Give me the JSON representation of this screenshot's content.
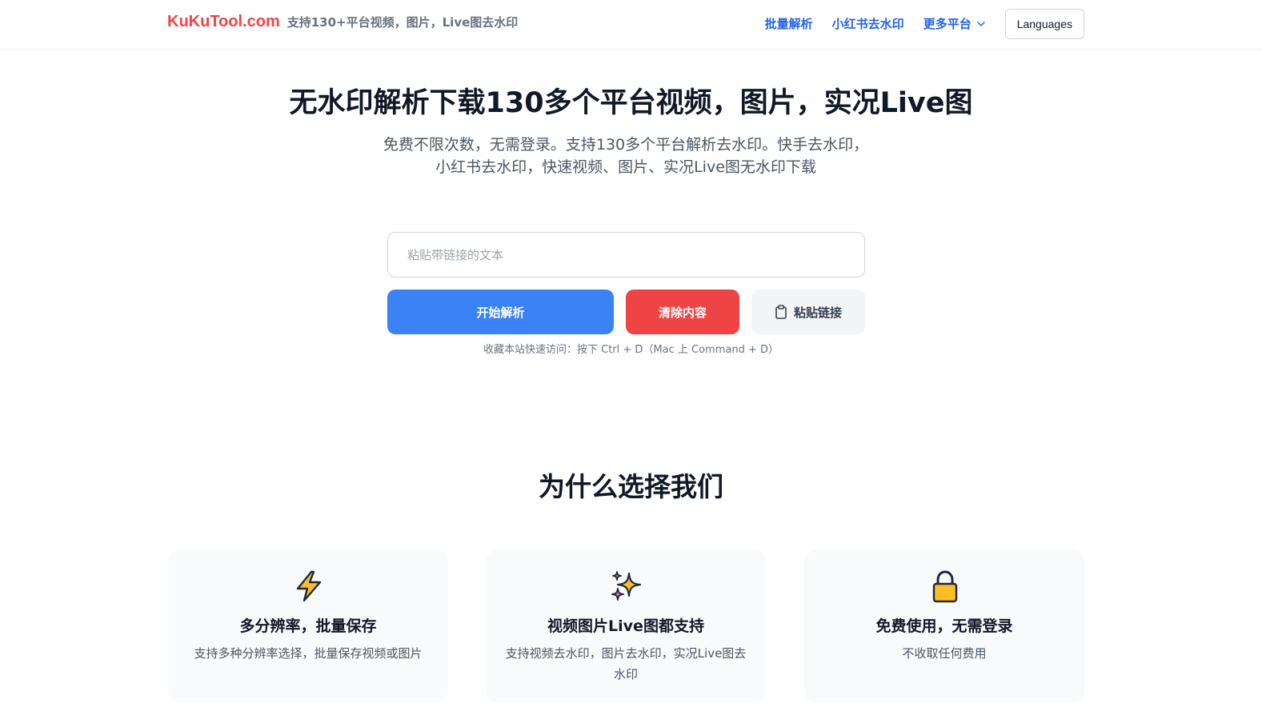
{
  "header": {
    "brand_name": "KuKuTool.com",
    "tagline": "支持130+平台视频，图片，Live图去水印",
    "nav": [
      {
        "label": "批量解析"
      },
      {
        "label": "小红书去水印"
      },
      {
        "label": "更多平台"
      }
    ],
    "languages_label": "Languages"
  },
  "hero": {
    "title": "无水印解析下载130多个平台视频，图片，实况Live图",
    "subtitle": "免费不限次数，无需登录。支持130多个平台解析去水印。快手去水印，小红书去水印，快速视频、图片、实况Live图无水印下载"
  },
  "search": {
    "placeholder": "粘贴带链接的文本",
    "value": ""
  },
  "actions": {
    "parse_label": "开始解析",
    "clear_label": "清除内容",
    "paste_label": "粘贴链接"
  },
  "hint": "收藏本站快速访问：按下 Ctrl + D（Mac 上 Command + D）",
  "why": {
    "title": "为什么选择我们",
    "cards": [
      {
        "icon": "lightning-icon",
        "title": "多分辨率，批量保存",
        "desc": "支持多种分辨率选择，批量保存视频或图片"
      },
      {
        "icon": "sparkles-icon",
        "title": "视频图片Live图都支持",
        "desc": "支持视频去水印，图片去水印，实况Live图去水印"
      },
      {
        "icon": "lock-icon",
        "title": "免费使用，无需登录",
        "desc": "不收取任何费用"
      }
    ]
  },
  "colors": {
    "brand": "#ef4444",
    "nav_link": "#2563eb",
    "primary": "#3b82f6",
    "danger": "#ef4444",
    "neutral_button": "#f3f4f6"
  }
}
